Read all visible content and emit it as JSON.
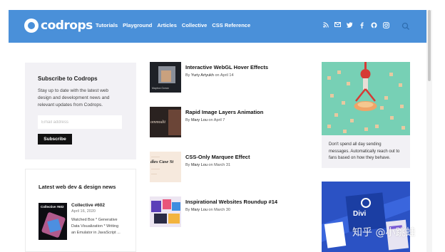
{
  "header": {
    "logo_text": "codrops",
    "nav": [
      "Tutorials",
      "Playground",
      "Articles",
      "Collective",
      "CSS Reference"
    ],
    "social_icons": [
      "rss-icon",
      "mail-icon",
      "twitter-icon",
      "facebook-icon",
      "github-icon",
      "instagram-icon"
    ],
    "search_icon": "search-icon",
    "color": "#4a90d9"
  },
  "subscribe": {
    "title": "Subscribe to Codrops",
    "description": "Stay up to date with the latest web design and development news and relevant updates from Codrops.",
    "email_placeholder": "Email address",
    "button_label": "Subscribe"
  },
  "news": {
    "title": "Latest web dev & design news",
    "item": {
      "thumb_label": "Collective #602",
      "title": "Collective #602",
      "date": "April 16, 2020",
      "description": "Watched Box * Generative Data Visualization * Writing an Emulator in JavaScript ..."
    }
  },
  "articles": [
    {
      "title": "Interactive WebGL Hover Effects",
      "by": "By",
      "author": "Yuriy Artyukh",
      "on": "on",
      "date": "April 14",
      "thumb_caption": "Mapbox Ocean"
    },
    {
      "title": "Rapid Image Layers Animation",
      "by": "By",
      "author": "Mary Lou",
      "on": "on",
      "date": "April 7",
      "thumb_caption": "ommodit"
    },
    {
      "title": "CSS-Only Marquee Effect",
      "by": "By",
      "author": "Mary Lou",
      "on": "on",
      "date": "March 31",
      "thumb_caption": "dies Case St"
    },
    {
      "title": "Inspirational Websites Roundup #14",
      "by": "By",
      "author": "Mary Lou",
      "on": "on",
      "date": "March 30",
      "thumb_caption": ""
    }
  ],
  "ads": {
    "ad1_text": "Don't spend all day sending messages. Automatically reach out to fans based on how they behave.",
    "ad2_text": "Divi"
  },
  "watermark": "知乎 @小跳蛙"
}
